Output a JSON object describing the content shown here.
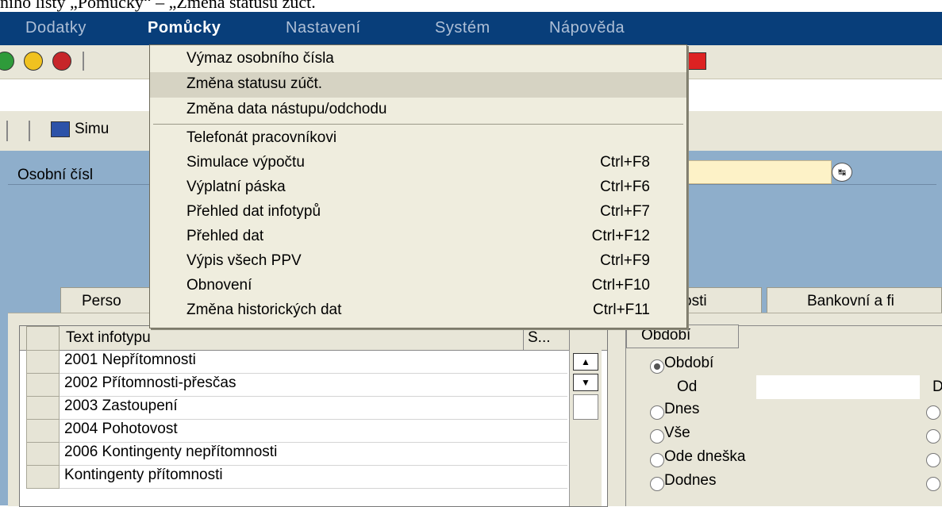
{
  "document_caption": "ního listy „Pomůcky“ – „Změna statusu zúčt.",
  "menubar": {
    "items": [
      {
        "label": "Dodatky"
      },
      {
        "label": "Pomůcky",
        "active": true
      },
      {
        "label": "Nastavení"
      },
      {
        "label": "Systém"
      },
      {
        "label": "Nápověda"
      }
    ]
  },
  "app_toolbar": {
    "simulation_button_label": "Simu"
  },
  "selection": {
    "personal_number_label": "Osobní čísl"
  },
  "tabs": [
    {
      "label": "Perso"
    },
    {
      "label": "osti"
    },
    {
      "label": "Bankovní a fi"
    }
  ],
  "infotype_table": {
    "headers": {
      "text": "Text infotypu",
      "status": "S..."
    },
    "rows": [
      "2001 Nepřítomnosti",
      "2002 Přítomnosti-přesčas",
      "2003 Zastoupení",
      "2004 Pohotovost",
      "2006 Kontingenty nepřítomnosti",
      "Kontingenty přítomnosti"
    ]
  },
  "period": {
    "group_label": "Období",
    "options": [
      {
        "label": "Období",
        "selected": true
      },
      {
        "label": "Dnes",
        "selected": false
      },
      {
        "label": "Vše",
        "selected": false
      },
      {
        "label": "Ode dneška",
        "selected": false
      },
      {
        "label": "Dodnes",
        "selected": false
      }
    ],
    "from_label": "Od",
    "to_label_partial": "D"
  },
  "dropdown_menu": {
    "items": [
      {
        "label": "Výmaz osobního čísla",
        "shortcut": ""
      },
      {
        "label": "Změna statusu zúčt.",
        "shortcut": "",
        "highlighted": true
      },
      {
        "label": "Změna data nástupu/odchodu",
        "shortcut": ""
      },
      {
        "label": "Telefonát pracovníkovi",
        "shortcut": ""
      },
      {
        "label": "Simulace výpočtu",
        "shortcut": "Ctrl+F8"
      },
      {
        "label": "Výplatní páska",
        "shortcut": "Ctrl+F6"
      },
      {
        "label": "Přehled dat infotypů",
        "shortcut": "Ctrl+F7"
      },
      {
        "label": "Přehled dat",
        "shortcut": "Ctrl+F12"
      },
      {
        "label": "Výpis všech PPV",
        "shortcut": "Ctrl+F9"
      },
      {
        "label": "Obnovení",
        "shortcut": "Ctrl+F10"
      },
      {
        "label": "Změna historických dat",
        "shortcut": "Ctrl+F11"
      }
    ]
  },
  "colors": {
    "menubar": "#083e7a",
    "background": "#8eaecb",
    "panel": "#e8e6d8",
    "highlight": "#d6d3c3"
  }
}
